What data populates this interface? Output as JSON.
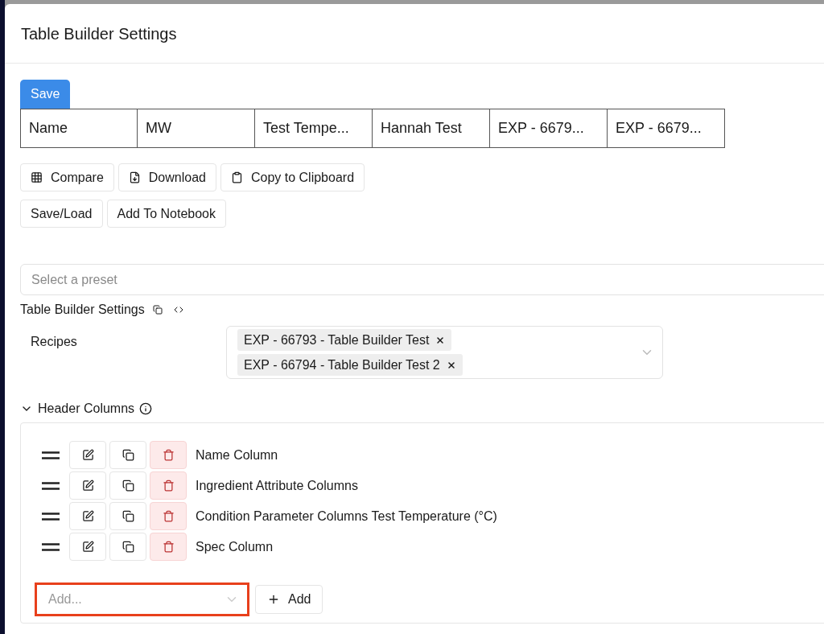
{
  "dialog": {
    "title": "Table Builder Settings"
  },
  "save_button": "Save",
  "preview_table": {
    "columns": [
      "Name",
      "MW",
      "Test Tempe...",
      "Hannah Test",
      "EXP - 6679...",
      "EXP - 6679..."
    ]
  },
  "actions": [
    {
      "label": "Compare",
      "kind": "grid"
    },
    {
      "label": "Download",
      "kind": "download"
    },
    {
      "label": "Copy to Clipboard",
      "kind": "clipboard"
    },
    {
      "label": "Save/Load",
      "kind": "plain"
    },
    {
      "label": "Add To Notebook",
      "kind": "plain"
    }
  ],
  "preset": {
    "placeholder": "Select a preset"
  },
  "settings": {
    "title": "Table Builder Settings",
    "recipes": {
      "label": "Recipes",
      "chips": [
        "EXP - 66793 - Table Builder Test",
        "EXP - 66794 - Table Builder Test 2"
      ]
    },
    "header_columns": {
      "title": "Header Columns",
      "expanded": true,
      "items": [
        {
          "label": "Name Column"
        },
        {
          "label": "Ingredient Attribute Columns"
        },
        {
          "label": "Condition Parameter Columns Test Temperature (°C)"
        },
        {
          "label": "Spec Column"
        }
      ],
      "add_field": {
        "placeholder": "Add...",
        "highlighted": true
      },
      "add_button": "Add"
    }
  }
}
